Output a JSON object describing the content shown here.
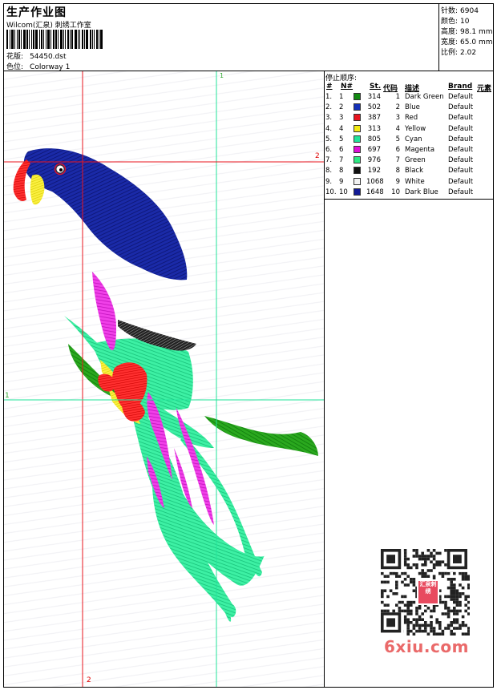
{
  "header": {
    "title": "生产作业图",
    "company": "Wilcom(汇泉) 刺绣工作室",
    "design_label": "花版:",
    "design_value": "54450.dst",
    "colorway_label": "色位:",
    "colorway_value": "Colorway 1"
  },
  "stats": {
    "stitches_label": "针数:",
    "stitches_value": "6904",
    "colors_label": "颜色:",
    "colors_value": "10",
    "height_label": "高度:",
    "height_value": "98.1 mm",
    "width_label": "宽度:",
    "width_value": "65.0 mm",
    "scale_label": "比例:",
    "scale_value": "2.02"
  },
  "guides": {
    "v1": "1",
    "v2": "2",
    "h1": "1",
    "h2": "2"
  },
  "thread_table": {
    "title": "停止顺序:",
    "headers": {
      "num": "#",
      "n": "N#",
      "st": "St.",
      "code": "代码",
      "desc": "描述",
      "brand": "Brand",
      "element": "元素"
    },
    "rows": [
      {
        "num": "1.",
        "n": "1",
        "st": "314",
        "code": "1",
        "desc": "Dark Green",
        "brand": "Default",
        "color": "#128a12"
      },
      {
        "num": "2.",
        "n": "2",
        "st": "502",
        "code": "2",
        "desc": "Blue",
        "brand": "Default",
        "color": "#1430b8"
      },
      {
        "num": "3.",
        "n": "3",
        "st": "387",
        "code": "3",
        "desc": "Red",
        "brand": "Default",
        "color": "#e8141e"
      },
      {
        "num": "4.",
        "n": "4",
        "st": "313",
        "code": "4",
        "desc": "Yellow",
        "brand": "Default",
        "color": "#f2ea14"
      },
      {
        "num": "5.",
        "n": "5",
        "st": "805",
        "code": "5",
        "desc": "Cyan",
        "brand": "Default",
        "color": "#22e39a"
      },
      {
        "num": "6.",
        "n": "6",
        "st": "697",
        "code": "6",
        "desc": "Magenta",
        "brand": "Default",
        "color": "#e010d6"
      },
      {
        "num": "7.",
        "n": "7",
        "st": "976",
        "code": "7",
        "desc": "Green",
        "brand": "Default",
        "color": "#2ee882"
      },
      {
        "num": "8.",
        "n": "8",
        "st": "192",
        "code": "8",
        "desc": "Black",
        "brand": "Default",
        "color": "#111111"
      },
      {
        "num": "9.",
        "n": "9",
        "st": "1068",
        "code": "9",
        "desc": "White",
        "brand": "Default",
        "color": "#f2f2f2"
      },
      {
        "num": "10.",
        "n": "10",
        "st": "1648",
        "code": "10",
        "desc": "Dark Blue",
        "brand": "Default",
        "color": "#121a96"
      }
    ]
  },
  "watermark": {
    "logo_text": "汇泉刺绣",
    "site": "6xiu.com"
  }
}
